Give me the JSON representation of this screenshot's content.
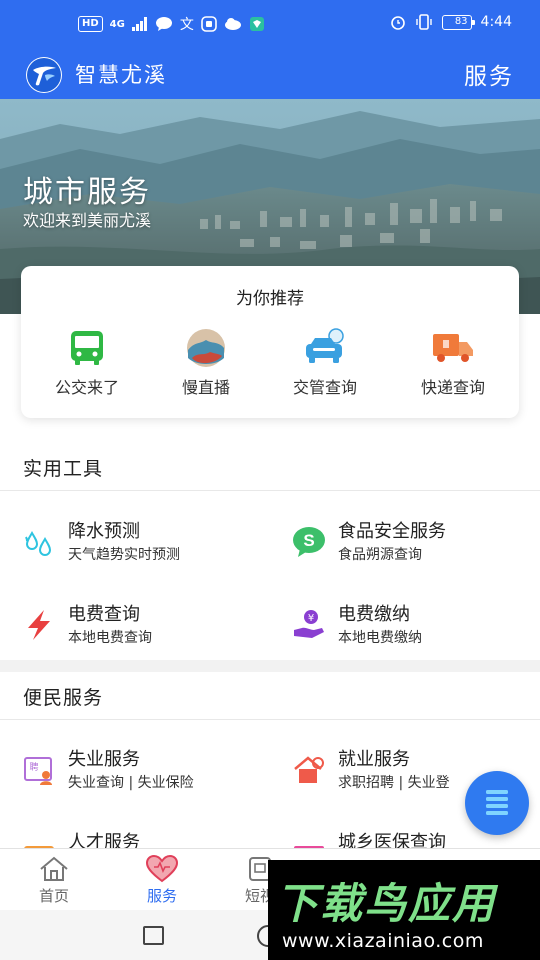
{
  "status_bar": {
    "left_chip": "HD",
    "network": "4G",
    "battery": "83",
    "time": "4:44"
  },
  "header": {
    "app_name": "智慧尤溪",
    "right_title": "服务"
  },
  "banner": {
    "title": "城市服务",
    "subtitle": "欢迎来到美丽尤溪"
  },
  "recommend": {
    "title": "为你推荐",
    "items": [
      {
        "label": "公交来了",
        "icon": "bus-icon"
      },
      {
        "label": "慢直播",
        "icon": "live-stream-icon"
      },
      {
        "label": "交管查询",
        "icon": "traffic-car-icon"
      },
      {
        "label": "快递查询",
        "icon": "delivery-truck-icon"
      }
    ]
  },
  "tools": {
    "title": "实用工具",
    "items": [
      {
        "title": "降水预测",
        "desc": "天气趋势实时预测",
        "icon": "rain-drops-icon"
      },
      {
        "title": "食品安全服务",
        "desc": "食品朔源查询",
        "icon": "food-safety-icon"
      },
      {
        "title": "电费查询",
        "desc": "本地电费查询",
        "icon": "lightning-icon"
      },
      {
        "title": "电费缴纳",
        "desc": "本地电费缴纳",
        "icon": "payment-hand-icon"
      }
    ]
  },
  "services": {
    "title": "便民服务",
    "items": [
      {
        "title": "失业服务",
        "desc": "失业查询 | 失业保险",
        "icon": "job-board-icon"
      },
      {
        "title": "就业服务",
        "desc": "求职招聘 | 失业登",
        "icon": "house-search-icon"
      },
      {
        "title": "人才服务",
        "desc": "",
        "icon": "talent-icon"
      },
      {
        "title": "城乡医保查询",
        "desc": "",
        "icon": "medical-insurance-icon"
      }
    ]
  },
  "tabs": [
    {
      "label": "首页",
      "icon": "home-icon"
    },
    {
      "label": "服务",
      "icon": "heart-icon"
    },
    {
      "label": "短视",
      "icon": "video-icon"
    }
  ],
  "watermark": {
    "brand": "下载鸟应用",
    "url": "www.xiazainiao.com"
  },
  "colors": {
    "primary": "#2f6df0",
    "bus_green": "#2fb844",
    "delivery_orange": "#f07a3a",
    "lightning_red": "#e84040",
    "payment_purple": "#8a3fd1",
    "watermark_green": "#7fe08a"
  }
}
